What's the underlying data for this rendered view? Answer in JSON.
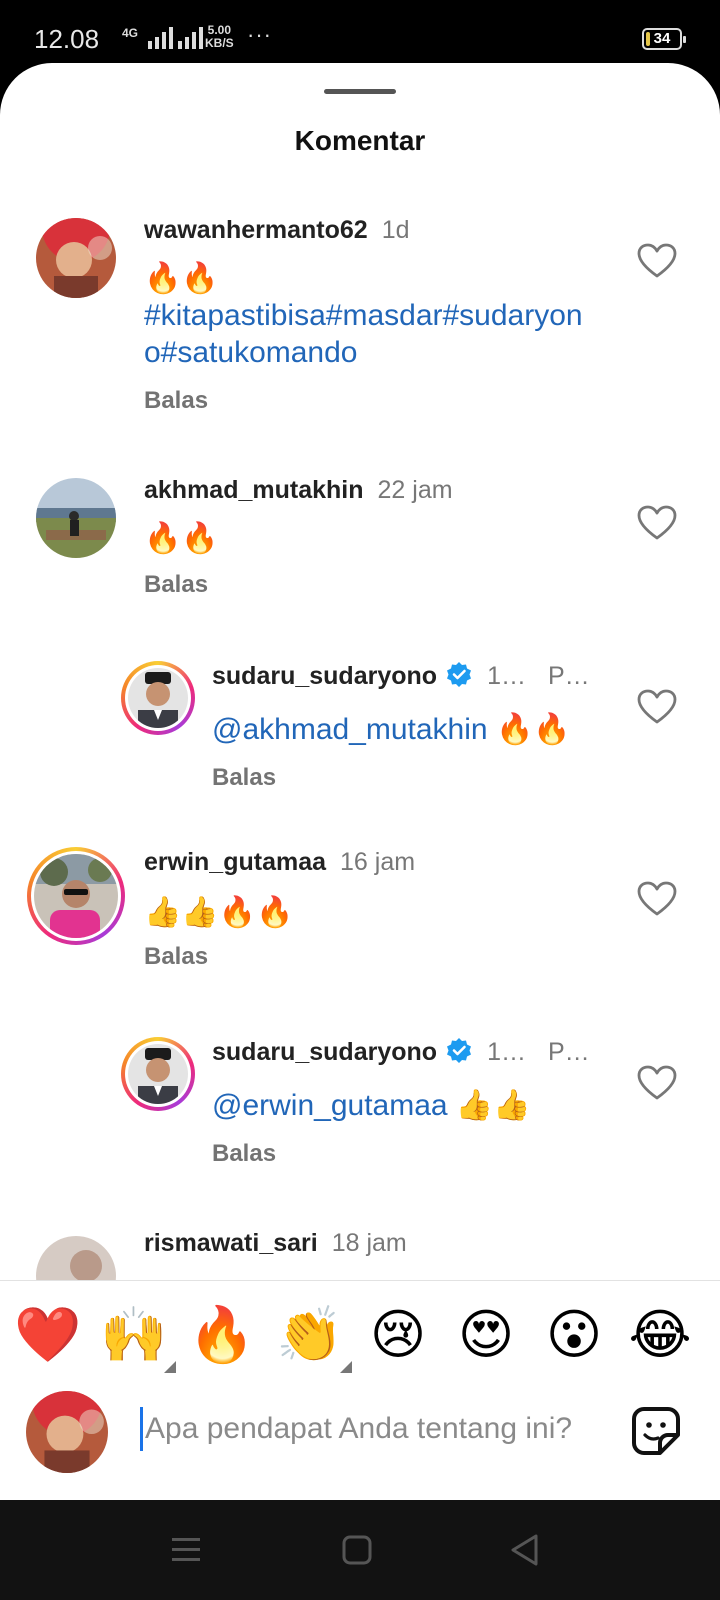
{
  "status_bar": {
    "time": "12.08",
    "network": "4G",
    "speed_value": "5.00",
    "speed_unit": "KB/S",
    "more": "···",
    "battery": "34"
  },
  "sheet": {
    "title": "Komentar"
  },
  "comments": [
    {
      "username": "wawanhermanto62",
      "time": "1d",
      "text_emoji": "🔥🔥",
      "text_link": "#kitapastibisa#masdar#sudaryono#satukomando",
      "reply_label": "Balas"
    },
    {
      "username": "akhmad_mutakhin",
      "time": "22 jam",
      "text_emoji": "🔥🔥",
      "reply_label": "Balas"
    },
    {
      "username": "sudaru_sudaryono",
      "time": "1…",
      "extra": "P…",
      "mention": "@akhmad_mutakhin",
      "text_emoji": "🔥🔥",
      "reply_label": "Balas"
    },
    {
      "username": "erwin_gutamaa",
      "time": "16 jam",
      "text_emoji": "👍👍🔥🔥",
      "reply_label": "Balas"
    },
    {
      "username": "sudaru_sudaryono",
      "time": "1…",
      "extra": "P…",
      "mention": "@erwin_gutamaa",
      "text_emoji": "👍👍",
      "reply_label": "Balas"
    },
    {
      "username": "rismawati_sari",
      "time": "18 jam"
    }
  ],
  "reactions": [
    "❤️",
    "🙌",
    "🔥",
    "👏",
    "😢",
    "😍",
    "😮",
    "😂"
  ],
  "input": {
    "placeholder": "Apa pendapat Anda tentang ini?"
  },
  "icons": {
    "heart": "heart-outline-icon",
    "verified": "verified-badge-icon",
    "sticker": "sticker-icon",
    "nav_recent": "menu-icon",
    "nav_home": "square-icon",
    "nav_back": "back-triangle-icon"
  },
  "colors": {
    "link": "#2166b8",
    "verified": "#1d9bf0",
    "cursor": "#1a73e8"
  }
}
